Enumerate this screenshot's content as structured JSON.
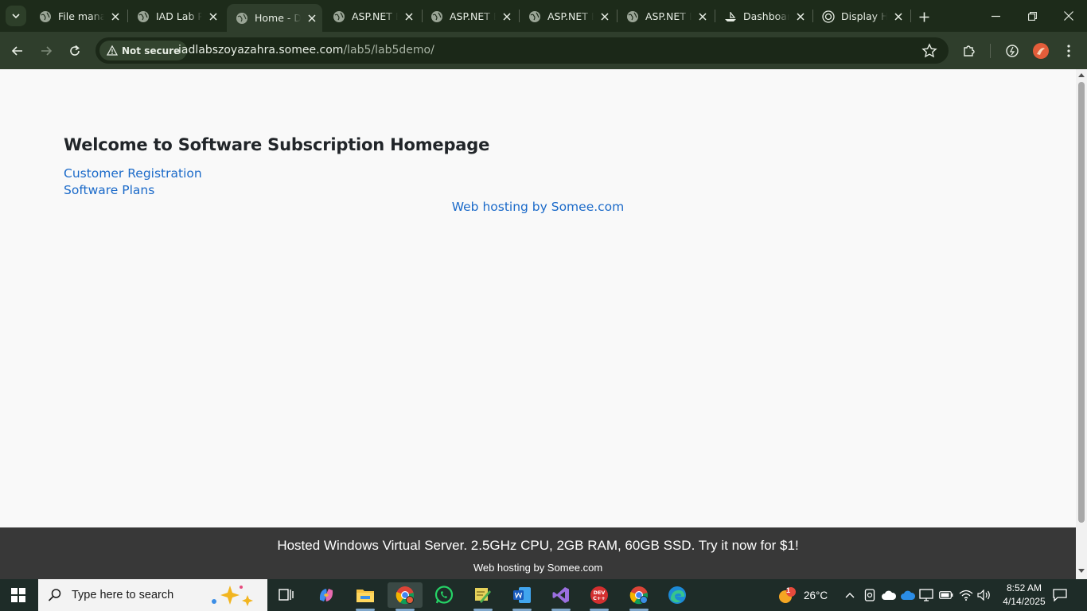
{
  "browser": {
    "tabs": [
      {
        "label": "File manager",
        "icon": "globe-icon",
        "active": false
      },
      {
        "label": "IAD Lab Portal",
        "icon": "globe-icon",
        "active": false
      },
      {
        "label": "Home - Demo",
        "icon": "globe-icon",
        "active": true
      },
      {
        "label": "ASP.NET Example",
        "icon": "globe-icon",
        "active": false
      },
      {
        "label": "ASP.NET Example",
        "icon": "globe-icon",
        "active": false
      },
      {
        "label": "ASP.NET Example",
        "icon": "globe-icon",
        "active": false
      },
      {
        "label": "ASP.NET Example",
        "icon": "globe-icon",
        "active": false
      },
      {
        "label": "Dashboard",
        "icon": "ship-icon",
        "active": false
      },
      {
        "label": "Display HTML",
        "icon": "openai-icon",
        "active": false
      }
    ],
    "security_label": "Not secure",
    "url_host": "iadlabszoyazahra.somee.com",
    "url_path": "/lab5/lab5demo/"
  },
  "page": {
    "title": "Welcome to Software Subscription Homepage",
    "links": [
      "Customer Registration",
      "Software Plans"
    ],
    "hosting_link": "Web hosting by Somee.com",
    "ad_text": "Hosted Windows Virtual Server. 2.5GHz CPU, 2GB RAM, 60GB SSD. Try it now for $1!",
    "ad_sub": "Web hosting by Somee.com"
  },
  "taskbar": {
    "search_placeholder": "Type here to search",
    "weather_badge": "1",
    "temperature": "26°C",
    "time": "8:52 AM",
    "date": "4/14/2025",
    "apps": [
      "task-view",
      "copilot",
      "file-explorer",
      "chrome",
      "whatsapp",
      "paint-tool",
      "word",
      "visual-studio",
      "dev-cpp",
      "chrome-profile",
      "edge"
    ]
  },
  "colors": {
    "tab_strip": "#1d2b1a",
    "toolbar": "#2f3e2c",
    "link": "#1b6ac9",
    "ad_bar": "#383838",
    "taskbar": "#1e2c28"
  }
}
